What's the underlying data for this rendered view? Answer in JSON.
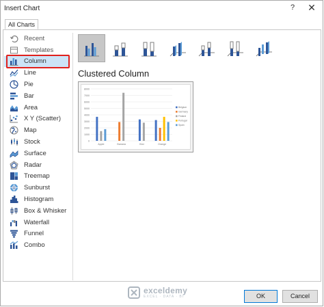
{
  "dialog": {
    "title": "Insert Chart",
    "help_label": "?",
    "close_label": "✕",
    "tab_label": "All Charts"
  },
  "sidebar": {
    "items": [
      {
        "label": "Recent",
        "icon": "recent-icon"
      },
      {
        "label": "Templates",
        "icon": "templates-icon"
      },
      {
        "label": "Column",
        "icon": "column-chart-icon",
        "selected": true
      },
      {
        "label": "Line",
        "icon": "line-chart-icon"
      },
      {
        "label": "Pie",
        "icon": "pie-chart-icon"
      },
      {
        "label": "Bar",
        "icon": "bar-chart-icon"
      },
      {
        "label": "Area",
        "icon": "area-chart-icon"
      },
      {
        "label": "X Y (Scatter)",
        "icon": "scatter-chart-icon"
      },
      {
        "label": "Map",
        "icon": "map-chart-icon"
      },
      {
        "label": "Stock",
        "icon": "stock-chart-icon"
      },
      {
        "label": "Surface",
        "icon": "surface-chart-icon"
      },
      {
        "label": "Radar",
        "icon": "radar-chart-icon"
      },
      {
        "label": "Treemap",
        "icon": "treemap-chart-icon"
      },
      {
        "label": "Sunburst",
        "icon": "sunburst-chart-icon"
      },
      {
        "label": "Histogram",
        "icon": "histogram-chart-icon"
      },
      {
        "label": "Box & Whisker",
        "icon": "box-whisker-chart-icon"
      },
      {
        "label": "Waterfall",
        "icon": "waterfall-chart-icon"
      },
      {
        "label": "Funnel",
        "icon": "funnel-chart-icon"
      },
      {
        "label": "Combo",
        "icon": "combo-chart-icon"
      }
    ]
  },
  "subtypes": [
    {
      "name": "clustered-column",
      "icon": "clustered-column-icon",
      "selected": true
    },
    {
      "name": "stacked-column",
      "icon": "stacked-column-icon"
    },
    {
      "name": "100-stacked-column",
      "icon": "100-stacked-column-icon"
    },
    {
      "name": "3d-clustered-column",
      "icon": "3d-clustered-column-icon"
    },
    {
      "name": "3d-stacked-column",
      "icon": "3d-stacked-column-icon"
    },
    {
      "name": "3d-100-stacked-column",
      "icon": "3d-100-stacked-column-icon"
    },
    {
      "name": "3d-column",
      "icon": "3d-column-icon"
    }
  ],
  "preview": {
    "chart_title": "Clustered Column",
    "chart_data": {
      "type": "bar",
      "categories": [
        "Apple",
        "Banana",
        "Kiwi",
        "Orange"
      ],
      "ylim": [
        0,
        8000
      ],
      "yticks": [
        "0",
        "1000",
        "2000",
        "3000",
        "4000",
        "5000",
        "6000",
        "7000",
        "8000"
      ],
      "grid": true,
      "legend": "right",
      "series": [
        {
          "name": "Belgium",
          "color": "#4472c4",
          "values": [
            3700,
            0,
            3300,
            3200
          ]
        },
        {
          "name": "Germany",
          "color": "#ed7d31",
          "values": [
            0,
            2900,
            0,
            2000
          ]
        },
        {
          "name": "Finland",
          "color": "#a5a5a5",
          "values": [
            1500,
            7400,
            2800,
            0
          ]
        },
        {
          "name": "Portugal",
          "color": "#ffc000",
          "values": [
            0,
            0,
            0,
            3700
          ]
        },
        {
          "name": "Spain",
          "color": "#5b9bd5",
          "values": [
            1800,
            0,
            0,
            2900
          ]
        }
      ]
    }
  },
  "footer": {
    "ok_label": "OK",
    "cancel_label": "Cancel"
  },
  "watermark": {
    "name": "exceldemy",
    "tagline": "EXCEL · DATA · BI"
  },
  "colors": {
    "accent": "#4472c4",
    "selection_highlight": "#e0201c",
    "selected_bg": "#cce4f7"
  }
}
